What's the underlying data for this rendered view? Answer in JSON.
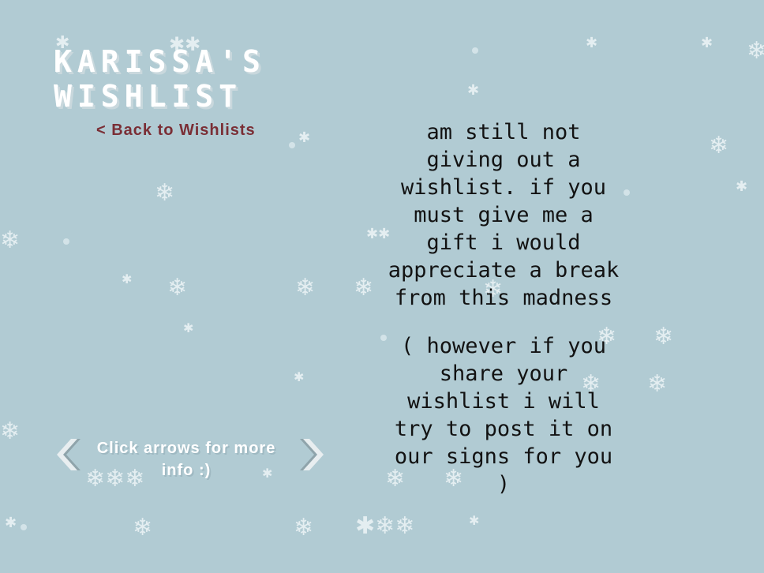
{
  "page": {
    "title_line1": "KARISSA'S",
    "title_line2": "WISHLIST",
    "back_link_label": "< Back to Wishlists"
  },
  "content": {
    "paragraph1": "am still not giving out a wishlist. if you must give me a gift i would appreciate a break from this madness",
    "paragraph2": "( however if you share your wishlist i will try to post it on our signs for you )"
  },
  "navigation": {
    "hint": "Click arrows for more info :)",
    "prev_icon": "chevron-left-icon",
    "next_icon": "chevron-right-icon"
  },
  "colors": {
    "background": "#b1cbd3",
    "title": "#ffffff",
    "back_link": "#7a2e35",
    "body_text": "#121212",
    "snow": "#e4eef1"
  }
}
